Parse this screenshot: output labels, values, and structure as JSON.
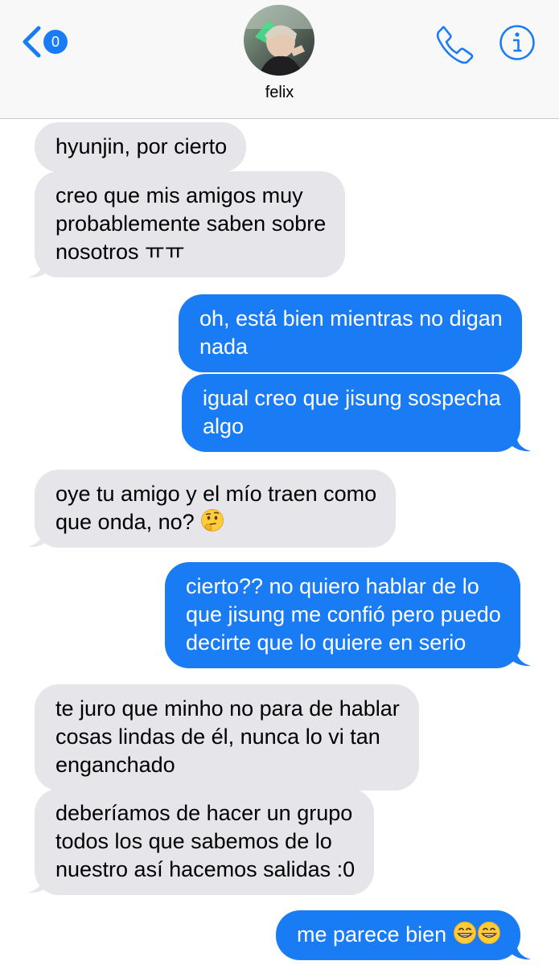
{
  "header": {
    "back_badge": "0",
    "contact_name": "felix"
  },
  "colors": {
    "accent": "#1a7cf5",
    "incoming_bubble": "#e5e5ea",
    "outgoing_bubble": "#1a7cf5"
  },
  "icons": {
    "back": "chevron-left-icon",
    "call": "phone-icon",
    "info": "info-icon",
    "thinking_emoji": "thinking-face-emoji",
    "grin_emoji": "grinning-face-emoji"
  },
  "messages": [
    {
      "dir": "in",
      "lines": [
        "hyunjin, por cierto"
      ]
    },
    {
      "dir": "in",
      "lines": [
        "creo que mis amigos muy",
        "probablemente saben sobre",
        "nosotros ㅠㅠ"
      ]
    },
    {
      "dir": "out",
      "lines": [
        "oh, está bien mientras no digan",
        "nada"
      ]
    },
    {
      "dir": "out",
      "lines": [
        "igual creo que jisung sospecha",
        "algo"
      ]
    },
    {
      "dir": "in",
      "lines": [
        "oye tu amigo y el mío traen como",
        "que onda, no?"
      ]
    },
    {
      "dir": "out",
      "lines": [
        "cierto?? no quiero hablar de lo",
        "que jisung me confió pero puedo",
        "decirte que lo quiere en serio"
      ]
    },
    {
      "dir": "in",
      "lines": [
        "te juro que minho no para de hablar",
        "cosas lindas de él, nunca lo vi tan",
        "enganchado"
      ]
    },
    {
      "dir": "in",
      "lines": [
        "deberíamos de hacer un grupo",
        "todos los que sabemos de lo",
        "nuestro así hacemos salidas :0"
      ]
    },
    {
      "dir": "out",
      "lines": [
        "me parece bien"
      ]
    }
  ]
}
